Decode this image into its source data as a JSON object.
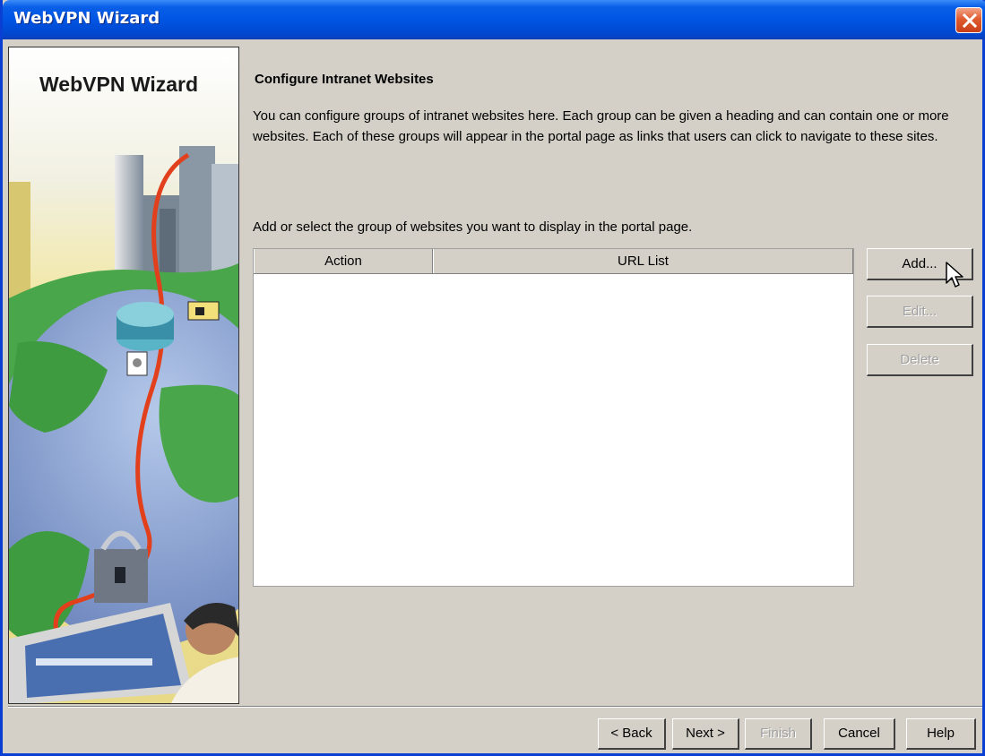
{
  "window": {
    "title": "WebVPN Wizard"
  },
  "side_panel": {
    "title": "WebVPN Wizard"
  },
  "content": {
    "heading": "Configure Intranet Websites",
    "description": "You can configure groups of intranet websites here. Each group can be given a heading and can contain one or more websites. Each of these groups will appear in the portal page as links that users can click to navigate to these sites.",
    "instruction": "Add or select the group of websites you want to display in the portal page."
  },
  "table": {
    "columns": [
      "Action",
      "URL List"
    ],
    "rows": []
  },
  "side_buttons": {
    "add": "Add...",
    "edit": "Edit...",
    "delete": "Delete"
  },
  "footer_buttons": {
    "back": "< Back",
    "next": "Next >",
    "finish": "Finish",
    "cancel": "Cancel",
    "help": "Help"
  },
  "colors": {
    "titlebar": "#0055e3",
    "window_bg": "#d4d0c8",
    "close_button": "#e05b2f",
    "disabled_text": "#a0a0a0"
  }
}
